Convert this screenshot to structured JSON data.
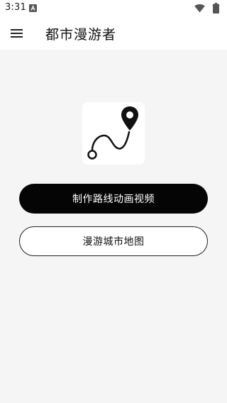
{
  "status_bar": {
    "time": "3:31",
    "notification_icon": "a-notification-icon",
    "wifi_icon": "wifi-icon",
    "battery_icon": "battery-icon"
  },
  "app_bar": {
    "menu_icon": "hamburger-menu-icon",
    "title": "都市漫游者"
  },
  "main": {
    "logo_icon": "route-pin-icon",
    "primary_button_label": "制作路线动画视频",
    "secondary_button_label": "漫游城市地图"
  },
  "colors": {
    "primary_button_bg": "#050505",
    "page_bg": "#f5f5f5",
    "surface": "#ffffff"
  }
}
